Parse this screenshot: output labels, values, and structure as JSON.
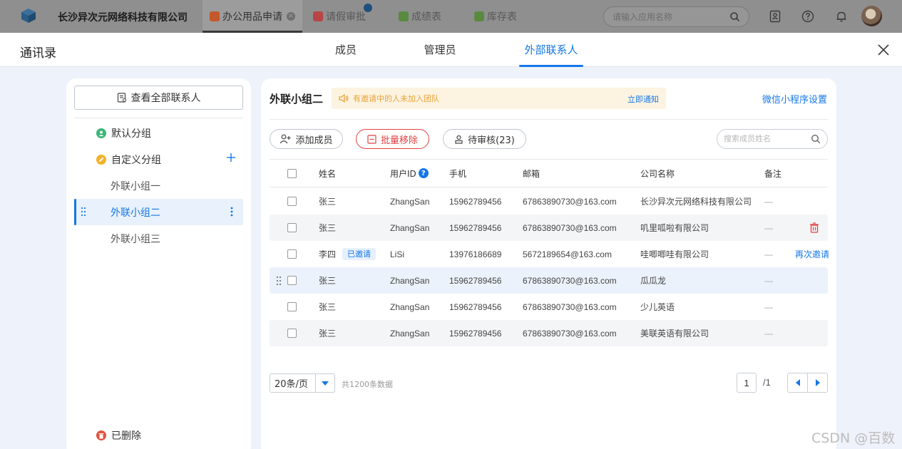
{
  "appbar": {
    "company": "长沙异次元网络科技有限公司",
    "tabs": [
      {
        "label": "办公用品申请",
        "color": "#c2582c",
        "active": true
      },
      {
        "label": "请假审批",
        "color": "#b84646",
        "active": false
      },
      {
        "label": "成绩表",
        "color": "#5a8a3f",
        "active": false
      },
      {
        "label": "库存表",
        "color": "#5a8a3f",
        "active": false
      }
    ],
    "search_placeholder": "请输入应用名称"
  },
  "modal": {
    "title": "通讯录",
    "tabs": [
      "成员",
      "管理员",
      "外部联系人"
    ],
    "active_tab": "外部联系人"
  },
  "sidebar": {
    "view_all": "查看全部联系人",
    "default_group": "默认分组",
    "custom_group": "自定义分组",
    "subgroups": [
      "外联小组一",
      "外联小组二",
      "外联小组三"
    ],
    "active_subgroup": "外联小组二",
    "deleted": "已删除"
  },
  "main": {
    "title": "外联小组二",
    "notice": "有邀请中的人未加入团队",
    "notify_link": "立即通知",
    "settings_link": "微信小程序设置",
    "add_member": "添加成员",
    "batch_remove": "批量移除",
    "pending": "待审核(23)",
    "search_placeholder": "搜索成员姓名"
  },
  "table": {
    "headers": {
      "name": "姓名",
      "user_id": "用户ID",
      "phone": "手机",
      "email": "邮箱",
      "company": "公司名称",
      "note": "备注"
    },
    "rows": [
      {
        "name": "张三",
        "user_id": "ZhangSan",
        "phone": "15962789456",
        "email": "67863890730@163.com",
        "company": "长沙异次元网络科技有限公司",
        "note": "—"
      },
      {
        "name": "张三",
        "user_id": "ZhangSan",
        "phone": "15962789456",
        "email": "67863890730@163.com",
        "company": "叽里呱啦有限公司",
        "note": "—"
      },
      {
        "name": "李四",
        "tag": "已邀请",
        "user_id": "LiSi",
        "phone": "13976186689",
        "email": "5672189654@163.com",
        "company": "哇唧唧哇有限公司",
        "note": "—",
        "action": "再次邀请"
      },
      {
        "name": "张三",
        "user_id": "ZhangSan",
        "phone": "15962789456",
        "email": "67863890730@163.com",
        "company": "瓜瓜龙",
        "note": "—"
      },
      {
        "name": "张三",
        "user_id": "ZhangSan",
        "phone": "15962789456",
        "email": "67863890730@163.com",
        "company": "少儿英语",
        "note": "—"
      },
      {
        "name": "张三",
        "user_id": "ZhangSan",
        "phone": "15962789456",
        "email": "67863890730@163.com",
        "company": "美联英语有限公司",
        "note": "—"
      }
    ]
  },
  "pagination": {
    "page_size": "20条/页",
    "total": "共1200条数据",
    "current": "1",
    "pages": "/1"
  },
  "watermark": "CSDN @百数",
  "colors": {
    "accent": "#1677e8",
    "danger": "#e34141",
    "warning": "#e8a33a"
  }
}
